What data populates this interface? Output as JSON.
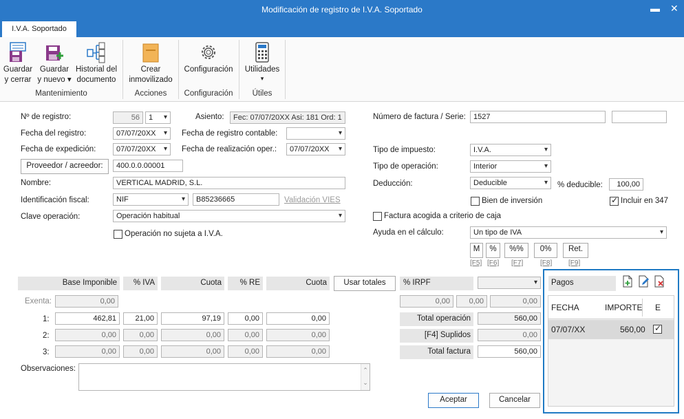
{
  "window": {
    "title": "Modificación de registro de I.V.A. Soportado",
    "minimize": "▬",
    "close": "✕"
  },
  "tabs": [
    {
      "label": "I.V.A. Soportado"
    }
  ],
  "ribbon": {
    "buttons": {
      "guardar_cerrar": [
        "Guardar",
        "y cerrar"
      ],
      "guardar_nuevo": [
        "Guardar",
        "y nuevo ▾"
      ],
      "historial": [
        "Historial del",
        "documento"
      ],
      "crear_inmovilizado": [
        "Crear",
        "inmovilizado"
      ],
      "configuracion": [
        "Configuración"
      ],
      "utilidades": [
        "Utilidades",
        "▾"
      ]
    },
    "groups": {
      "mantenimiento": "Mantenimiento",
      "acciones": "Acciones",
      "configuracion": "Configuración",
      "utiles": "Útiles"
    }
  },
  "form": {
    "labels": {
      "num_registro": "Nº de registro:",
      "fecha_registro": "Fecha del registro:",
      "fecha_expedicion": "Fecha de expedición:",
      "nombre": "Nombre:",
      "identificacion": "Identificación fiscal:",
      "clave": "Clave operación:",
      "asiento": "Asiento:",
      "fecha_contable": "Fecha de registro contable:",
      "fecha_realizacion": "Fecha de realización oper.:",
      "num_factura": "Número de factura / Serie:",
      "tipo_impuesto": "Tipo de impuesto:",
      "tipo_operacion": "Tipo de operación:",
      "deduccion": "Deducción:",
      "pct_deducible": "% deducible:",
      "ayuda_calculo": "Ayuda en el cálculo:",
      "observaciones": "Observaciones:"
    },
    "values": {
      "num_registro": "56",
      "num_registro_serie": "1",
      "asiento": "Fec: 07/07/20XX Asi: 181 Ord: 1",
      "fecha_registro": "07/07/20XX",
      "fecha_contable": "",
      "fecha_expedicion": "07/07/20XX",
      "fecha_realizacion": "07/07/20XX",
      "proveedor_code": "400.0.0.00001",
      "nombre": "VERTICAL MADRID, S.L.",
      "id_tipo": "NIF",
      "id_num": "B85236665",
      "clave": "Operación habitual",
      "num_factura": "1527",
      "serie": "",
      "tipo_impuesto": "I.V.A.",
      "tipo_operacion": "Interior",
      "deduccion": "Deducible",
      "pct_deducible": "100,00",
      "ayuda_calculo": "Un tipo de IVA",
      "observaciones": ""
    },
    "proveedor_button": "Proveedor / acreedor:",
    "validacion_vies": "Validación VIES",
    "checkboxes": {
      "no_sujeta": {
        "label": "Operación no sujeta a I.V.A.",
        "checked": false
      },
      "bien_inversion": {
        "label": "Bien de inversión",
        "checked": false
      },
      "incluir_347": {
        "label": "Incluir en 347",
        "checked": true
      },
      "criterio_caja": {
        "label": "Factura acogida a criterio de caja",
        "checked": false
      }
    },
    "calc_buttons": [
      {
        "label": "M",
        "key": "[F5]"
      },
      {
        "label": "%",
        "key": "[F6]"
      },
      {
        "label": "%%",
        "key": "[F7]"
      },
      {
        "label": "0%",
        "key": "[F8]"
      },
      {
        "label": "Ret.",
        "key": "[F9]"
      }
    ]
  },
  "tax_table": {
    "headers": {
      "base": "Base Imponible",
      "pct_iva": "% IVA",
      "cuota": "Cuota",
      "pct_re": "% RE",
      "cuota_re": "Cuota",
      "usar_totales": "Usar totales",
      "pct_irpf": "% IRPF"
    },
    "exenta": {
      "label": "Exenta:",
      "value": "0,00"
    },
    "rows": [
      {
        "label": "1:",
        "base": "462,81",
        "pct_iva": "21,00",
        "cuota": "97,19",
        "pct_re": "0,00",
        "cuota_re": "0,00"
      },
      {
        "label": "2:",
        "base": "0,00",
        "pct_iva": "0,00",
        "cuota": "0,00",
        "pct_re": "0,00",
        "cuota_re": "0,00"
      },
      {
        "label": "3:",
        "base": "0,00",
        "pct_iva": "0,00",
        "cuota": "0,00",
        "pct_re": "0,00",
        "cuota_re": "0,00"
      }
    ],
    "irpf": {
      "type": "",
      "v1": "0,00",
      "v2": "0,00",
      "v3": "0,00"
    },
    "totals": {
      "total_operacion_label": "Total operación",
      "total_operacion": "560,00",
      "suplidos_label": "[F4] Suplidos",
      "suplidos": "0,00",
      "total_factura_label": "Total factura",
      "total_factura": "560,00"
    }
  },
  "pagos": {
    "title": "Pagos",
    "headers": {
      "fecha": "FECHA",
      "importe": "IMPORTE",
      "e": "E"
    },
    "rows": [
      {
        "fecha": "07/07/XX",
        "importe": "560,00",
        "e": true
      }
    ]
  },
  "footer": {
    "aceptar": "Aceptar",
    "cancelar": "Cancelar"
  },
  "colors": {
    "title_bar": "#2b79c8",
    "highlight_border": "#1f7ac4",
    "row_selected": "#d9d9d9"
  }
}
